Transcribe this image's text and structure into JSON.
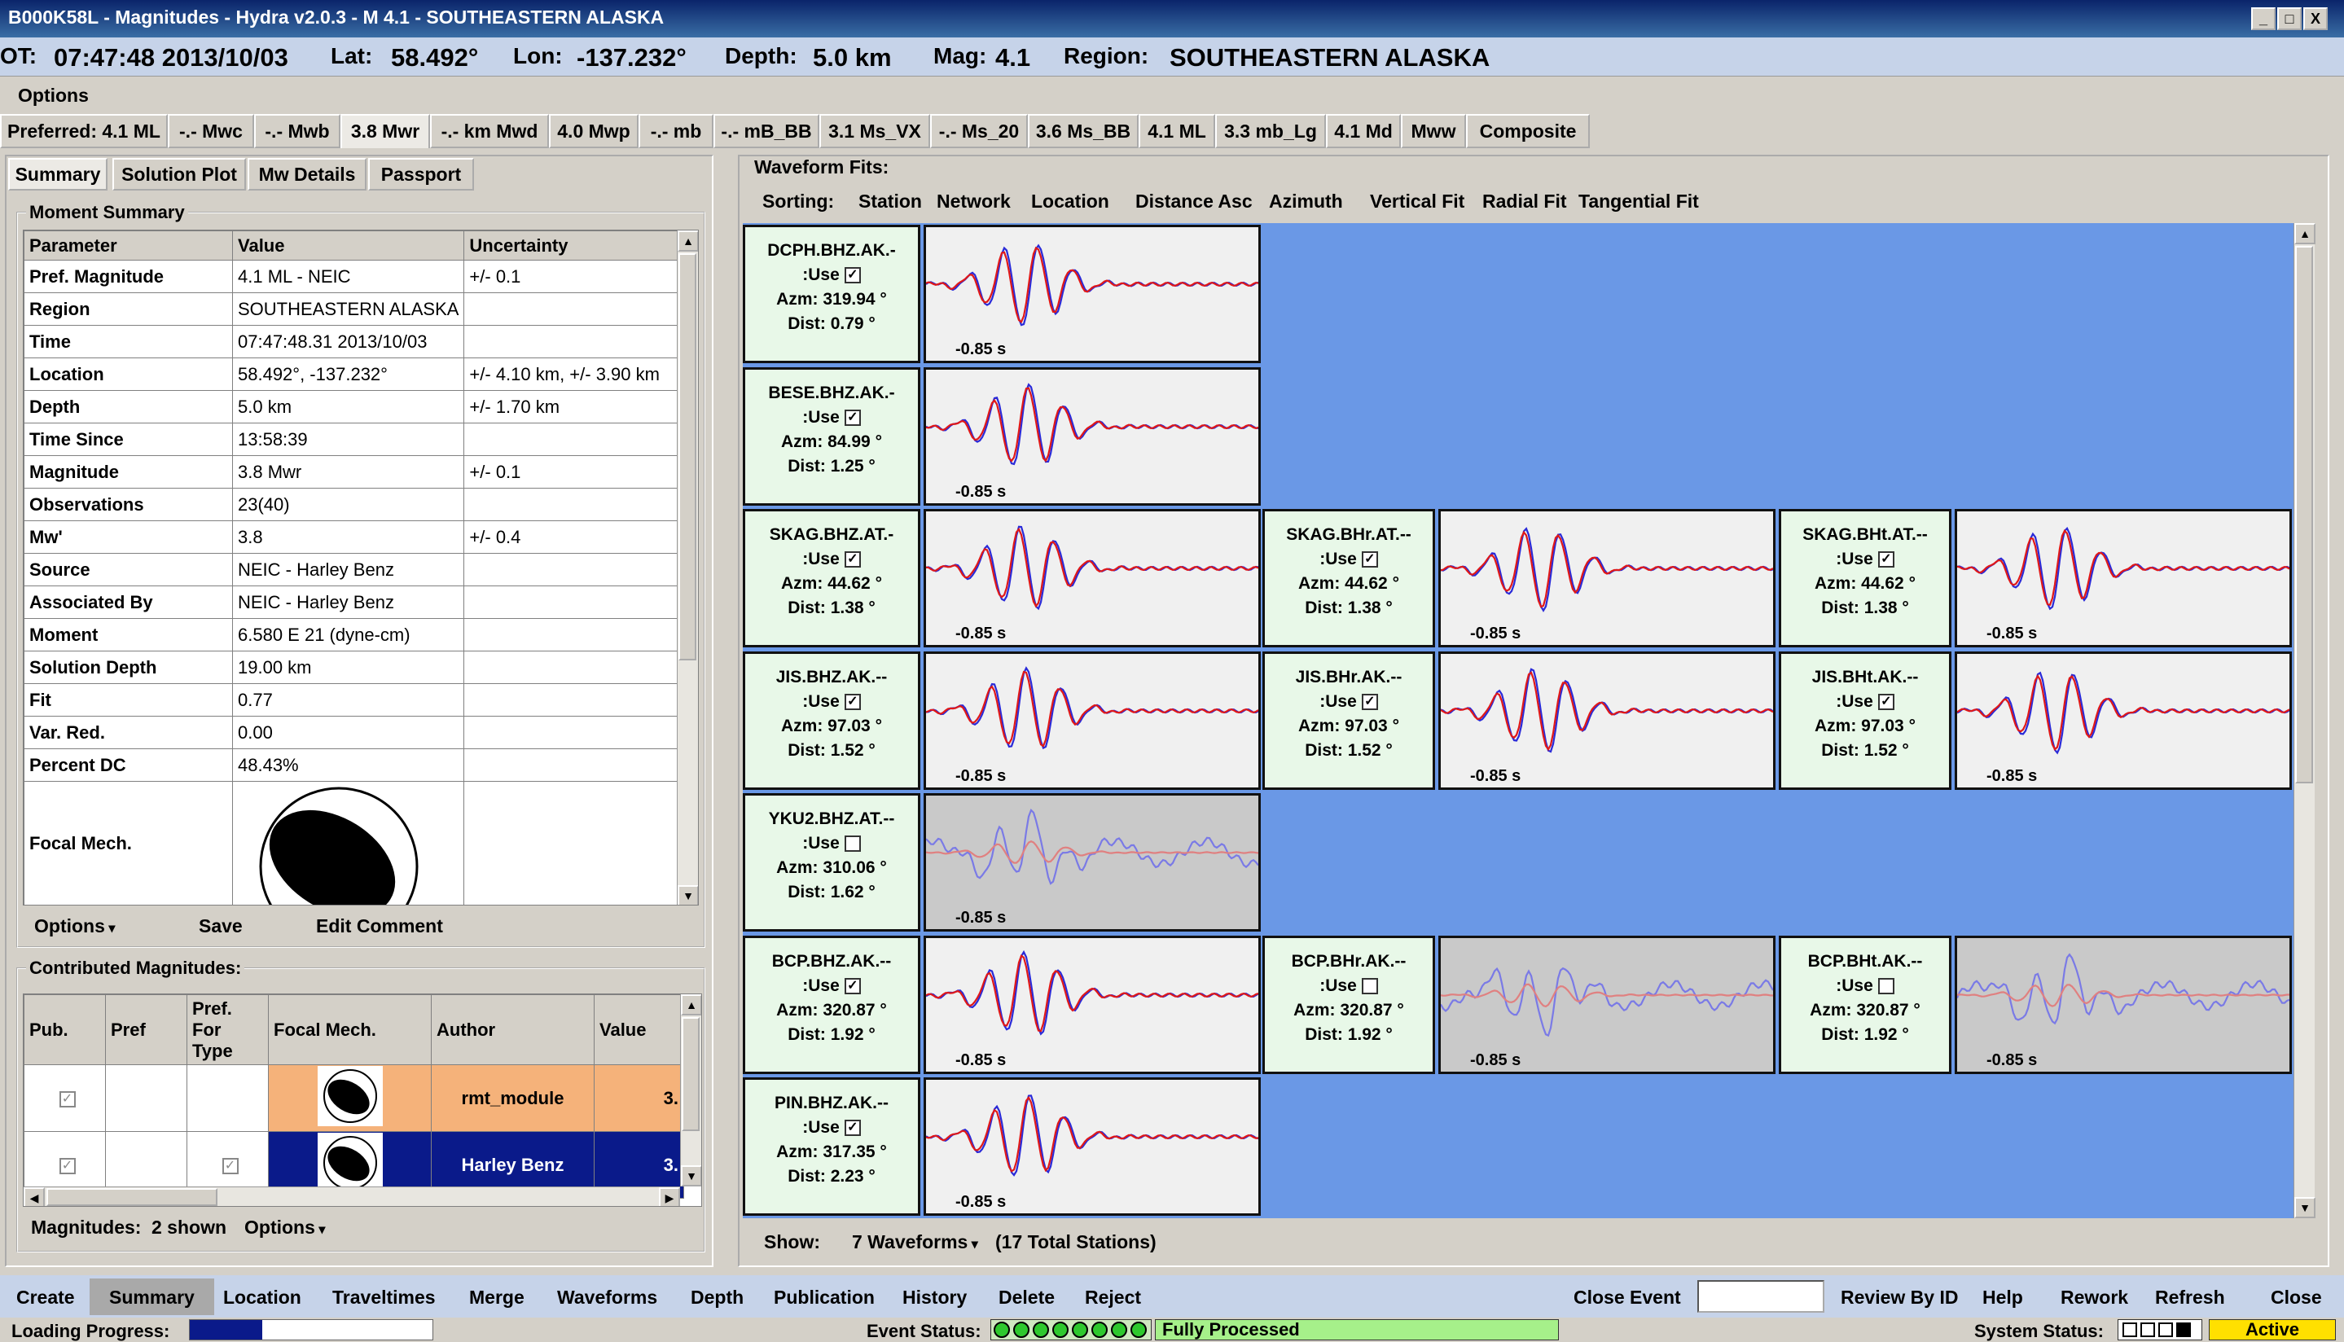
{
  "window": {
    "title": "B000K58L - Magnitudes - Hydra v2.0.3 -  M 4.1  - SOUTHEASTERN ALASKA",
    "buttons": [
      "_",
      "□",
      "X"
    ]
  },
  "header": {
    "ot_label": "OT:",
    "ot_value": "07:47:48 2013/10/03",
    "lat_label": "Lat:",
    "lat_value": "58.492°",
    "lon_label": "Lon:",
    "lon_value": "-137.232°",
    "depth_label": "Depth:",
    "depth_value": "5.0 km",
    "mag_label": "Mag:",
    "mag_value": "4.1",
    "region_label": "Region:",
    "region_value": "SOUTHEASTERN ALASKA"
  },
  "menu": {
    "options": "Options"
  },
  "mag_tabs": [
    "Preferred: 4.1 ML",
    "-.- Mwc",
    "-.- Mwb",
    "3.8 Mwr",
    "-.- km Mwd",
    "4.0 Mwp",
    "-.- mb",
    "-.- mB_BB",
    "3.1 Ms_VX",
    "-.- Ms_20",
    "3.6 Ms_BB",
    "4.1 ML",
    "3.3 mb_Lg",
    "4.1 Md",
    "Mww",
    "Composite"
  ],
  "sub_tabs": [
    "Summary",
    "Solution Plot",
    "Mw Details",
    "Passport"
  ],
  "moment_summary": {
    "title": "Moment Summary",
    "columns": [
      "Parameter",
      "Value",
      "Uncertainty"
    ],
    "rows": [
      [
        "Pref. Magnitude",
        "4.1 ML - NEIC",
        "+/- 0.1"
      ],
      [
        "Region",
        "SOUTHEASTERN ALASKA",
        ""
      ],
      [
        "Time",
        "07:47:48.31 2013/10/03",
        ""
      ],
      [
        "Location",
        "58.492°, -137.232°",
        "+/- 4.10 km, +/- 3.90 km"
      ],
      [
        "Depth",
        "5.0 km",
        "+/- 1.70 km"
      ],
      [
        "Time Since",
        "13:58:39",
        ""
      ],
      [
        "Magnitude",
        "3.8 Mwr",
        "+/- 0.1"
      ],
      [
        "Observations",
        "23(40)",
        ""
      ],
      [
        "Mw'",
        "3.8",
        "+/- 0.4"
      ],
      [
        "Source",
        "NEIC - Harley Benz",
        ""
      ],
      [
        "Associated By",
        "NEIC - Harley Benz",
        ""
      ],
      [
        "Moment",
        "6.580 E 21 (dyne-cm)",
        ""
      ],
      [
        "Solution Depth",
        "19.00 km",
        ""
      ],
      [
        "Fit",
        "0.77",
        ""
      ],
      [
        "Var. Red.",
        "0.00",
        ""
      ],
      [
        "Percent DC",
        "48.43%",
        ""
      ]
    ],
    "focal_label": "Focal Mech.",
    "buttons": {
      "options": "Options",
      "save": "Save",
      "edit_comment": "Edit Comment"
    }
  },
  "contributed": {
    "title": "Contributed Magnitudes:",
    "columns": [
      "Pub.",
      "Pref",
      "Pref. For Type",
      "Focal Mech.",
      "Author",
      "Value"
    ],
    "rows": [
      {
        "author": "rmt_module",
        "value": "3.",
        "pub": true,
        "pref_type": false,
        "color": "#f5b27a"
      },
      {
        "author": "Harley Benz",
        "value": "3.",
        "pub": true,
        "pref_type": true,
        "color": "#0a1a8a"
      }
    ],
    "footer_label": "Magnitudes:",
    "footer_count": "2 shown",
    "footer_options": "Options"
  },
  "waveforms": {
    "title": "Waveform Fits:",
    "sorting_label": "Sorting:",
    "sort_options": [
      "Station",
      "Network",
      "Location",
      "Distance Asc",
      "Azimuth"
    ],
    "fit_options": [
      "Vertical Fit",
      "Radial Fit",
      "Tangential Fit"
    ],
    "lag": "-0.85 s",
    "use_label": ":Use",
    "stations": [
      {
        "name": "DCPH.BHZ.AK.-",
        "use": true,
        "azm": "Azm: 319.94 °",
        "dist": "Dist: 0.79 °"
      },
      {
        "name": "BESE.BHZ.AK.-",
        "use": true,
        "azm": "Azm: 84.99 °",
        "dist": "Dist: 1.25 °"
      },
      {
        "name": "SKAG.BHZ.AT.-",
        "use": true,
        "azm": "Azm: 44.62 °",
        "dist": "Dist: 1.38 °"
      },
      {
        "name": "SKAG.BHr.AT.--",
        "use": true,
        "azm": "Azm: 44.62 °",
        "dist": "Dist: 1.38 °"
      },
      {
        "name": "SKAG.BHt.AT.--",
        "use": true,
        "azm": "Azm: 44.62 °",
        "dist": "Dist: 1.38 °"
      },
      {
        "name": "JIS.BHZ.AK.--",
        "use": true,
        "azm": "Azm: 97.03 °",
        "dist": "Dist: 1.52 °"
      },
      {
        "name": "JIS.BHr.AK.--",
        "use": true,
        "azm": "Azm: 97.03 °",
        "dist": "Dist: 1.52 °"
      },
      {
        "name": "JIS.BHt.AK.--",
        "use": true,
        "azm": "Azm: 97.03 °",
        "dist": "Dist: 1.52 °"
      },
      {
        "name": "YKU2.BHZ.AT.--",
        "use": false,
        "azm": "Azm: 310.06 °",
        "dist": "Dist: 1.62 °"
      },
      {
        "name": "BCP.BHZ.AK.--",
        "use": true,
        "azm": "Azm: 320.87 °",
        "dist": "Dist: 1.92 °"
      },
      {
        "name": "BCP.BHr.AK.--",
        "use": false,
        "azm": "Azm: 320.87 °",
        "dist": "Dist: 1.92 °"
      },
      {
        "name": "BCP.BHt.AK.--",
        "use": false,
        "azm": "Azm: 320.87 °",
        "dist": "Dist: 1.92 °"
      },
      {
        "name": "PIN.BHZ.AK.--",
        "use": true,
        "azm": "Azm: 317.35 °",
        "dist": "Dist: 2.23 °"
      }
    ],
    "show_label": "Show:",
    "show_value": "7 Waveforms",
    "total": "(17 Total Stations)"
  },
  "bottom_nav": [
    "Create",
    "Summary",
    "Location",
    "Traveltimes",
    "Merge",
    "Waveforms",
    "Depth",
    "Publication",
    "History",
    "Delete",
    "Reject"
  ],
  "bottom_right": {
    "close_event": "Close Event",
    "review_by_id": "Review By ID",
    "help": "Help",
    "rework": "Rework",
    "refresh": "Refresh",
    "close": "Close"
  },
  "status": {
    "loading_label": "Loading Progress:",
    "loading_fraction": 0.3,
    "event_status_label": "Event Status:",
    "event_status_value": "Fully Processed",
    "system_status_label": "System Status:",
    "system_status_value": "Active"
  }
}
